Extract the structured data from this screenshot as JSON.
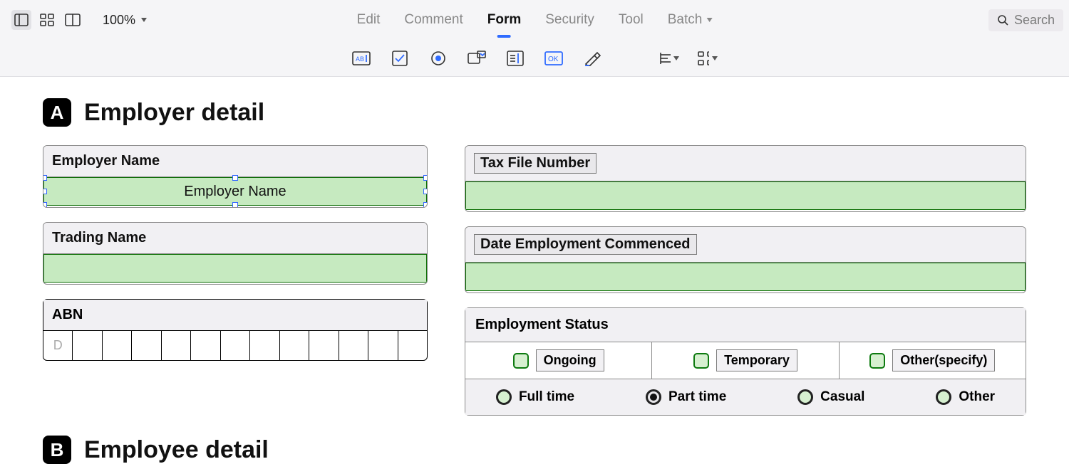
{
  "toolbar": {
    "zoom": "100%",
    "tabs": [
      "Edit",
      "Comment",
      "Form",
      "Security",
      "Tool",
      "Batch"
    ],
    "active_tab": "Form",
    "search_placeholder": "Search"
  },
  "form_tools": [
    "text-field-tool",
    "checkbox-tool",
    "radio-tool",
    "combobox-tool",
    "listbox-tool",
    "ok-button-tool",
    "signature-tool",
    "align-tool",
    "distribute-tool"
  ],
  "section_a": {
    "badge": "A",
    "title": "Employer detail",
    "employer_name_label": "Employer Name",
    "employer_name_field_placeholder": "Employer Name",
    "trading_name_label": "Trading Name",
    "abn_label": "ABN",
    "abn_cells": [
      "D",
      "",
      "",
      "",
      "",
      "",
      "",
      "",
      "",
      "",
      "",
      "",
      ""
    ],
    "tfn_label": "Tax File Number",
    "date_employment_label": "Date Employment Commenced",
    "employment_status_label": "Employment Status",
    "status_checks": [
      "Ongoing",
      "Temporary",
      "Other(specify)"
    ],
    "status_radios": [
      "Full time",
      "Part time",
      "Casual",
      "Other"
    ],
    "status_radio_selected": "Part time"
  },
  "section_b": {
    "badge": "B",
    "title": "Employee detail"
  }
}
